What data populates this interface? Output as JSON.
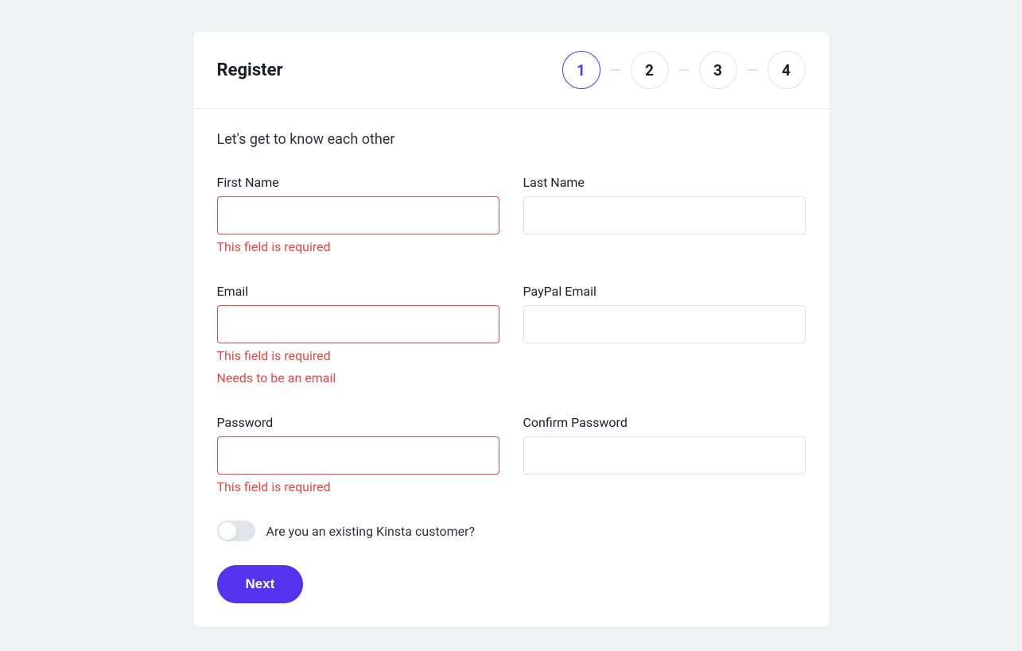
{
  "header": {
    "title": "Register",
    "steps": [
      "1",
      "2",
      "3",
      "4"
    ],
    "active_step": 0
  },
  "subtitle": "Let's get to know each other",
  "fields": {
    "first_name": {
      "label": "First Name",
      "value": "",
      "errors": [
        "This field is required"
      ]
    },
    "last_name": {
      "label": "Last Name",
      "value": "",
      "errors": []
    },
    "email": {
      "label": "Email",
      "value": "",
      "errors": [
        "This field is required",
        "Needs to be an email"
      ]
    },
    "paypal_email": {
      "label": "PayPal Email",
      "value": "",
      "errors": []
    },
    "password": {
      "label": "Password",
      "value": "",
      "errors": [
        "This field is required"
      ]
    },
    "confirm_password": {
      "label": "Confirm Password",
      "value": "",
      "errors": []
    }
  },
  "toggle": {
    "label": "Are you an existing Kinsta customer?",
    "checked": false
  },
  "actions": {
    "next_label": "Next"
  },
  "colors": {
    "accent": "#5333ed",
    "error": "#ef4444",
    "bg": "#f0f1f5"
  }
}
